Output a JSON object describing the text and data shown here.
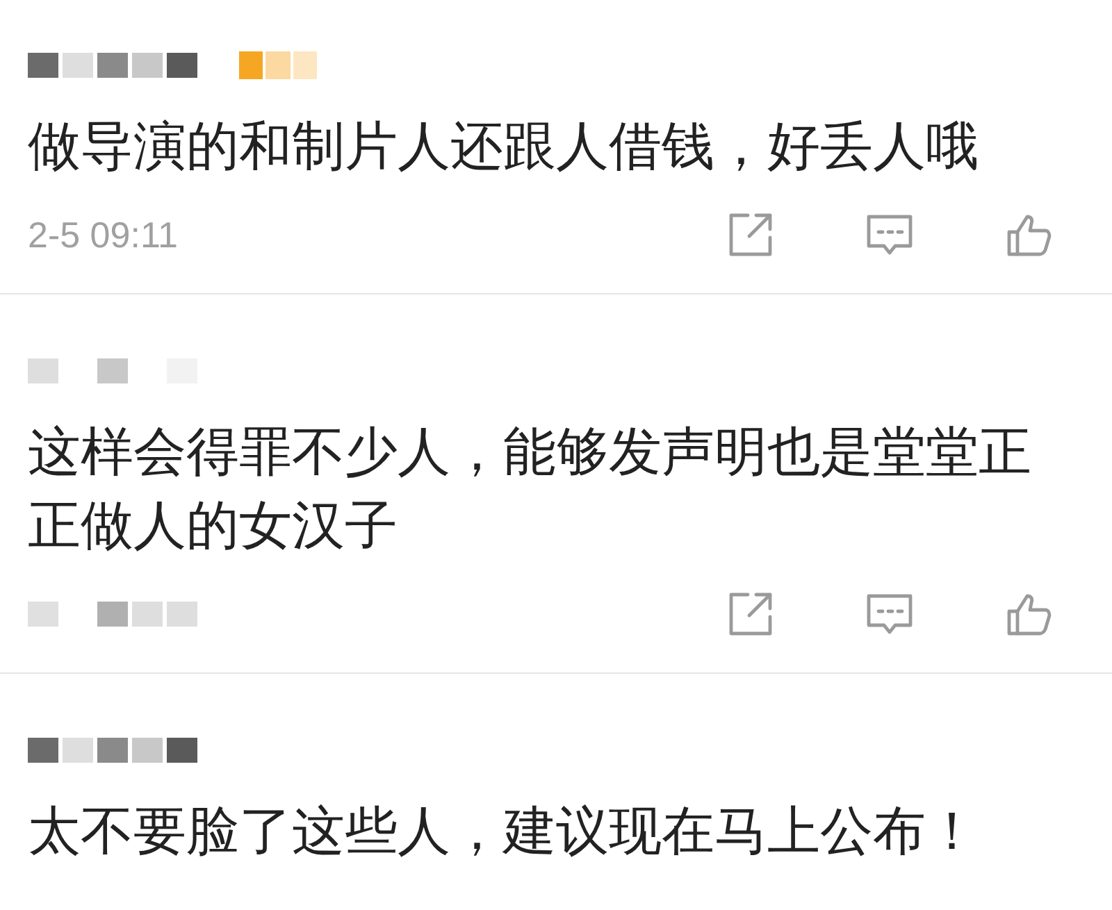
{
  "comments": [
    {
      "text": "做导演的和制片人还跟人借钱，好丢人哦",
      "time": "2-5 09:11",
      "actions": true
    },
    {
      "text": "这样会得罪不少人，能够发声明也是堂堂正正做人的女汉子",
      "actions": true
    },
    {
      "text": "太不要脸了这些人，建议现在马上公布！",
      "actions": false
    }
  ]
}
